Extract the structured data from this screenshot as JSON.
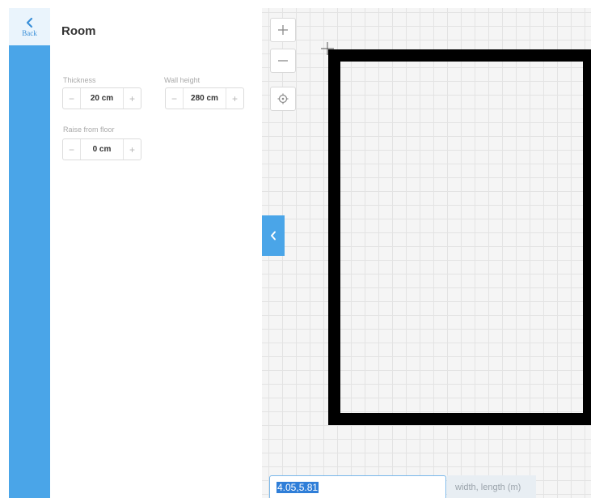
{
  "rail": {
    "back_label": "Back"
  },
  "panel": {
    "title": "Room",
    "thickness": {
      "label": "Thickness",
      "value": "20 cm"
    },
    "wall_height": {
      "label": "Wall height",
      "value": "280 cm"
    },
    "raise_from_floor": {
      "label": "Raise from floor",
      "value": "0 cm"
    },
    "minus_symbol": "−",
    "plus_symbol": "+"
  },
  "canvas": {
    "zoom_in_icon": "plus-icon",
    "zoom_out_icon": "minus-icon",
    "center_icon": "target-icon",
    "collapse_icon": "chevron-left-icon"
  },
  "dimensions": {
    "value": "4.05,5.81",
    "hint": "width, length (m)"
  },
  "colors": {
    "accent": "#4aa5e8",
    "wall": "#000000",
    "grid": "#e3e3e3"
  }
}
